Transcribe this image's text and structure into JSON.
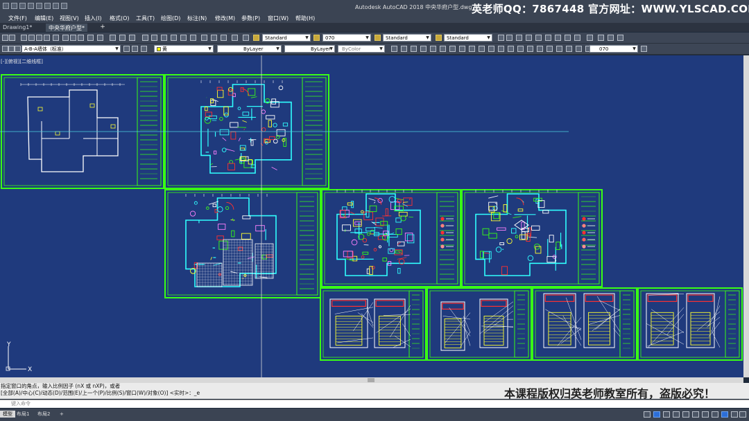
{
  "window": {
    "app_title": "Autodesk AutoCAD 2018    中央华府户型.dwg",
    "brand_text": "英老师QQ：7867448  官方网址：WWW.YLSCAD.COM"
  },
  "menu": [
    "文件(F)",
    "编辑(E)",
    "视图(V)",
    "插入(I)",
    "格式(O)",
    "工具(T)",
    "绘图(D)",
    "标注(N)",
    "修改(M)",
    "参数(P)",
    "窗口(W)",
    "帮助(H)"
  ],
  "tabs": [
    {
      "label": "Drawing1*",
      "active": false
    },
    {
      "label": "中央华府户型*",
      "active": true
    }
  ],
  "toolbar1": {
    "text_style": "Standard",
    "dim_style": "070",
    "table_style": "Standard",
    "mleader_style": "Standard"
  },
  "toolbar2": {
    "layer": "A-B-A墙体（标准）",
    "color": "黄",
    "linetype": "ByLayer",
    "lineweight": "ByLayer",
    "plotstyle": "ByColor",
    "dim_style": "070"
  },
  "viewport": {
    "label": "[-][俯视][二维线框]",
    "ucs_x": "X",
    "ucs_y": "Y",
    "colors": {
      "background": "#1f3a7d",
      "frame": "#39ff14",
      "crosshair": "#d8d8d8",
      "accent_red": "#ff3030",
      "accent_yellow": "#ffff30",
      "accent_cyan": "#30ffff"
    }
  },
  "command": {
    "history": [
      "指定窗口的角点，输入比例因子 (nX 或 nXP)，或者",
      "[全部(A)/中心(C)/动态(D)/范围(E)/上一个(P)/比例(S)/窗口(W)/对象(O)] <实时>：_e"
    ],
    "input_placeholder": "键入命令",
    "watermark": "本课程版权归英老师教室所有，盗版必究！"
  },
  "layout_tabs": [
    {
      "label": "模型",
      "active": true
    },
    {
      "label": "布局1",
      "active": false
    },
    {
      "label": "布局2",
      "active": false
    }
  ]
}
